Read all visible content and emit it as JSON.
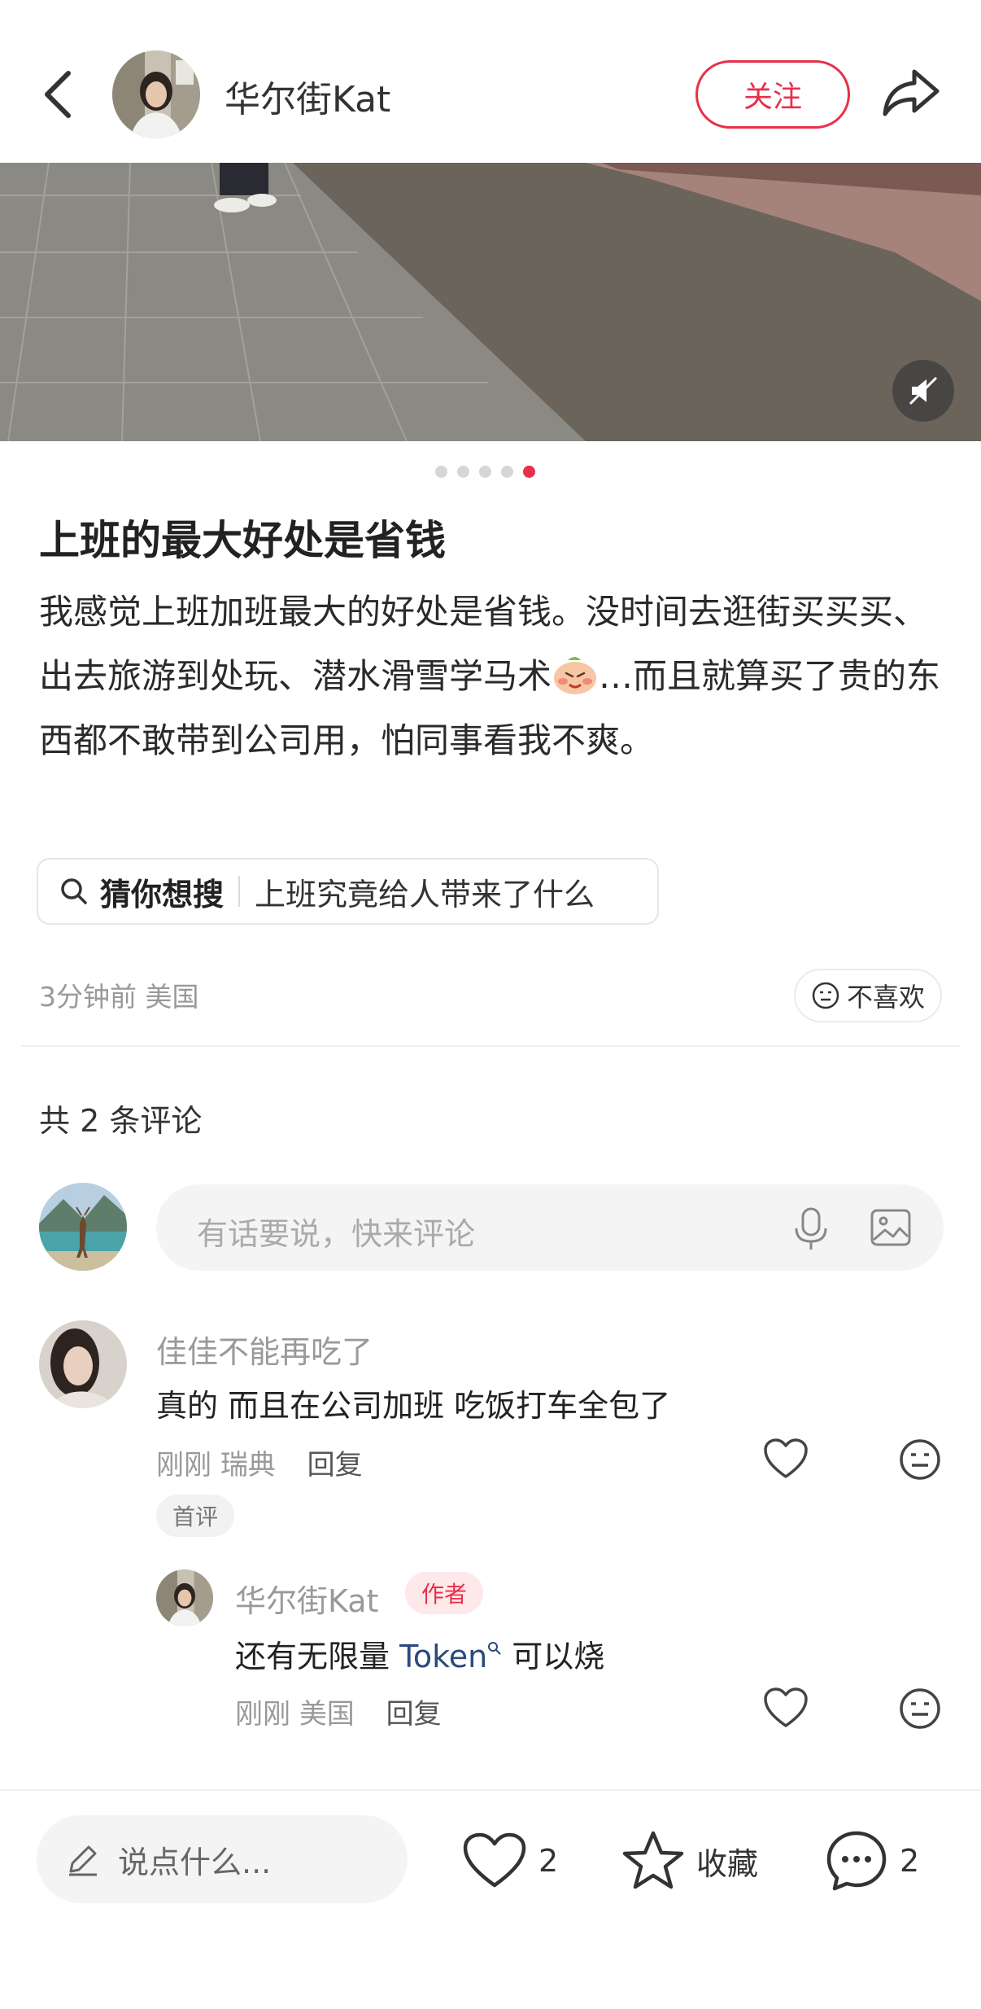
{
  "header": {
    "author_name": "华尔街Kat",
    "follow_label": "关注"
  },
  "carousel": {
    "count": 5,
    "active_index": 4
  },
  "post": {
    "title": "上班的最大好处是省钱",
    "body_part1": "我感觉上班加班最大的好处是省钱。没时间去逛街买买买、出去旅游到处玩、潜水滑雪学马术",
    "body_part2": "…而且就算买了贵的东西都不敢带到公司用，怕同事看我不爽。",
    "search_label": "猜你想搜",
    "search_suggestion": "上班究竟给人带来了什么",
    "time": "3分钟前",
    "location": "美国",
    "dislike_label": "不喜欢"
  },
  "comments_section": {
    "count_label": "共 2 条评论",
    "input_placeholder": "有话要说，快来评论",
    "comments": [
      {
        "name": "佳佳不能再吃了",
        "text": "真的 而且在公司加班 吃饭打车全包了",
        "time": "刚刚",
        "location": "瑞典",
        "reply_label": "回复",
        "badge": "首评"
      }
    ],
    "reply": {
      "name": "华尔街Kat",
      "badge": "作者",
      "text_before": "还有无限量 ",
      "link_text": "Token",
      "text_after": " 可以烧",
      "time": "刚刚",
      "location": "美国",
      "reply_label": "回复"
    }
  },
  "bottom_bar": {
    "input_placeholder": "说点什么...",
    "likes": "2",
    "collect_label": "收藏",
    "comments": "2"
  },
  "colors": {
    "accent": "#e8304a",
    "link": "#2a4a7b"
  }
}
